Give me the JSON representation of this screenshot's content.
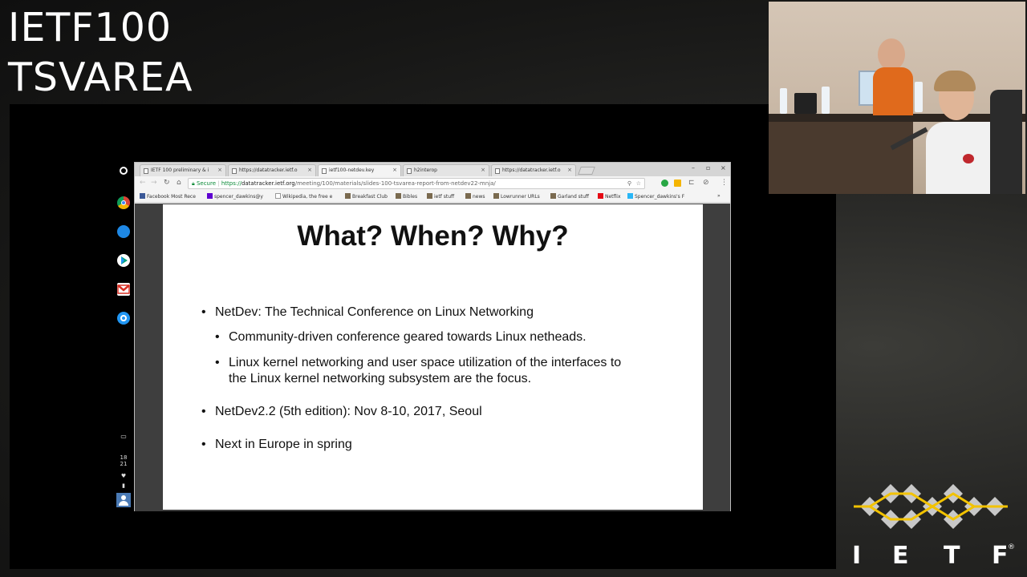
{
  "session": {
    "line1": "IETF100",
    "line2": "TSVAREA"
  },
  "shelf": {
    "time_hour": "18",
    "time_min": "21",
    "icons": [
      "launcher-icon",
      "chrome-icon",
      "files-icon",
      "play-store-icon",
      "gmail-icon",
      "settings-icon"
    ]
  },
  "browser": {
    "tabs": [
      {
        "label": "IETF 100 preliminary & i"
      },
      {
        "label": "https://datatracker.ietf.o"
      },
      {
        "label": "ietf100-netdev.key"
      },
      {
        "label": "h2interop"
      },
      {
        "label": "https://datatracker.ietf.o"
      }
    ],
    "url": {
      "secure_label": "Secure",
      "scheme": "https://",
      "host": "datatracker.ietf.org",
      "path": "/meeting/100/materials/slides-100-tsvarea-report-from-netdev22-mnja/"
    },
    "bookmarks": [
      "Facebook Most Rece",
      "spencer_dawkins@y",
      "Wikipedia, the free e",
      "Breakfast Club",
      "Bibles",
      "ietf stuff",
      "news",
      "Lowrunner URLs",
      "Garland stuff",
      "Netflix",
      "Spencer_dawkins's F"
    ]
  },
  "slide": {
    "title": "What? When? Why?",
    "bullets": [
      "NetDev: The Technical Conference on Linux Networking",
      "Community-driven conference geared towards Linux netheads.",
      "Linux kernel networking and user space utilization of the interfaces to",
      "the Linux kernel networking subsystem are the focus.",
      "NetDev2.2 (5th edition): Nov 8-10, 2017, Seoul",
      "Next in Europe in spring"
    ]
  },
  "logo": {
    "letters": [
      "I",
      "E",
      "T",
      "F"
    ],
    "registered": "®"
  },
  "colors": {
    "logo_zigzag": "#f2c200",
    "logo_diamond": "#c8c8c8",
    "secure_green": "#0a8a37"
  }
}
